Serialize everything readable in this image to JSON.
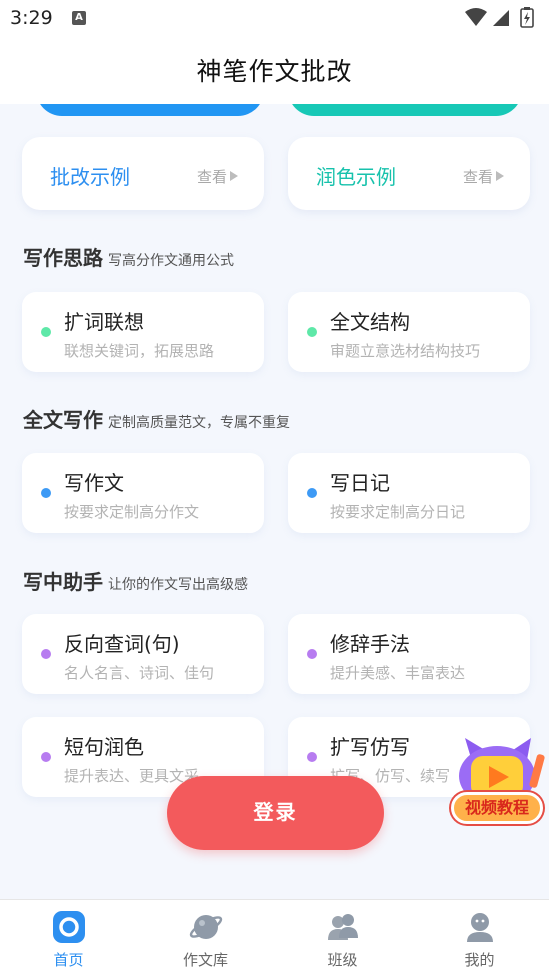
{
  "status_bar": {
    "time": "3:29",
    "notification_glyph": "A"
  },
  "header": {
    "title": "神笔作文批改"
  },
  "examples": [
    {
      "title": "批改示例",
      "link": "查看"
    },
    {
      "title": "润色示例",
      "link": "查看"
    }
  ],
  "sections": [
    {
      "title": "写作思路",
      "subtitle": "写高分作文通用公式",
      "dot_color": "#5ee8a8",
      "items": [
        {
          "title": "扩词联想",
          "desc": "联想关键词，拓展思路"
        },
        {
          "title": "全文结构",
          "desc": "审题立意选材结构技巧"
        }
      ]
    },
    {
      "title": "全文写作",
      "subtitle": "定制高质量范文，专属不重复",
      "dot_color": "#3d9af5",
      "items": [
        {
          "title": "写作文",
          "desc": "按要求定制高分作文"
        },
        {
          "title": "写日记",
          "desc": "按要求定制高分日记"
        }
      ]
    },
    {
      "title": "写中助手",
      "subtitle": "让你的作文写出高级感",
      "dot_color": "#b77cf0",
      "items": [
        {
          "title": "反向查词(句)",
          "desc": "名人名言、诗词、佳句"
        },
        {
          "title": "修辞手法",
          "desc": "提升美感、丰富表达"
        },
        {
          "title": "短句润色",
          "desc": "提升表达、更具文采"
        },
        {
          "title": "扩写仿写",
          "desc": "扩写、仿写、续写"
        }
      ]
    }
  ],
  "login_button": "登录",
  "video_tutorial": {
    "label": "视频教程"
  },
  "bottom_nav": [
    {
      "label": "首页",
      "icon": "home-icon",
      "active": true
    },
    {
      "label": "作文库",
      "icon": "planet-icon",
      "active": false
    },
    {
      "label": "班级",
      "icon": "class-icon",
      "active": false
    },
    {
      "label": "我的",
      "icon": "profile-icon",
      "active": false
    }
  ],
  "colors": {
    "accent_blue": "#2d8ff0",
    "accent_teal": "#17c2ac",
    "login_red": "#f35a5c",
    "background": "#f4f7fd"
  }
}
